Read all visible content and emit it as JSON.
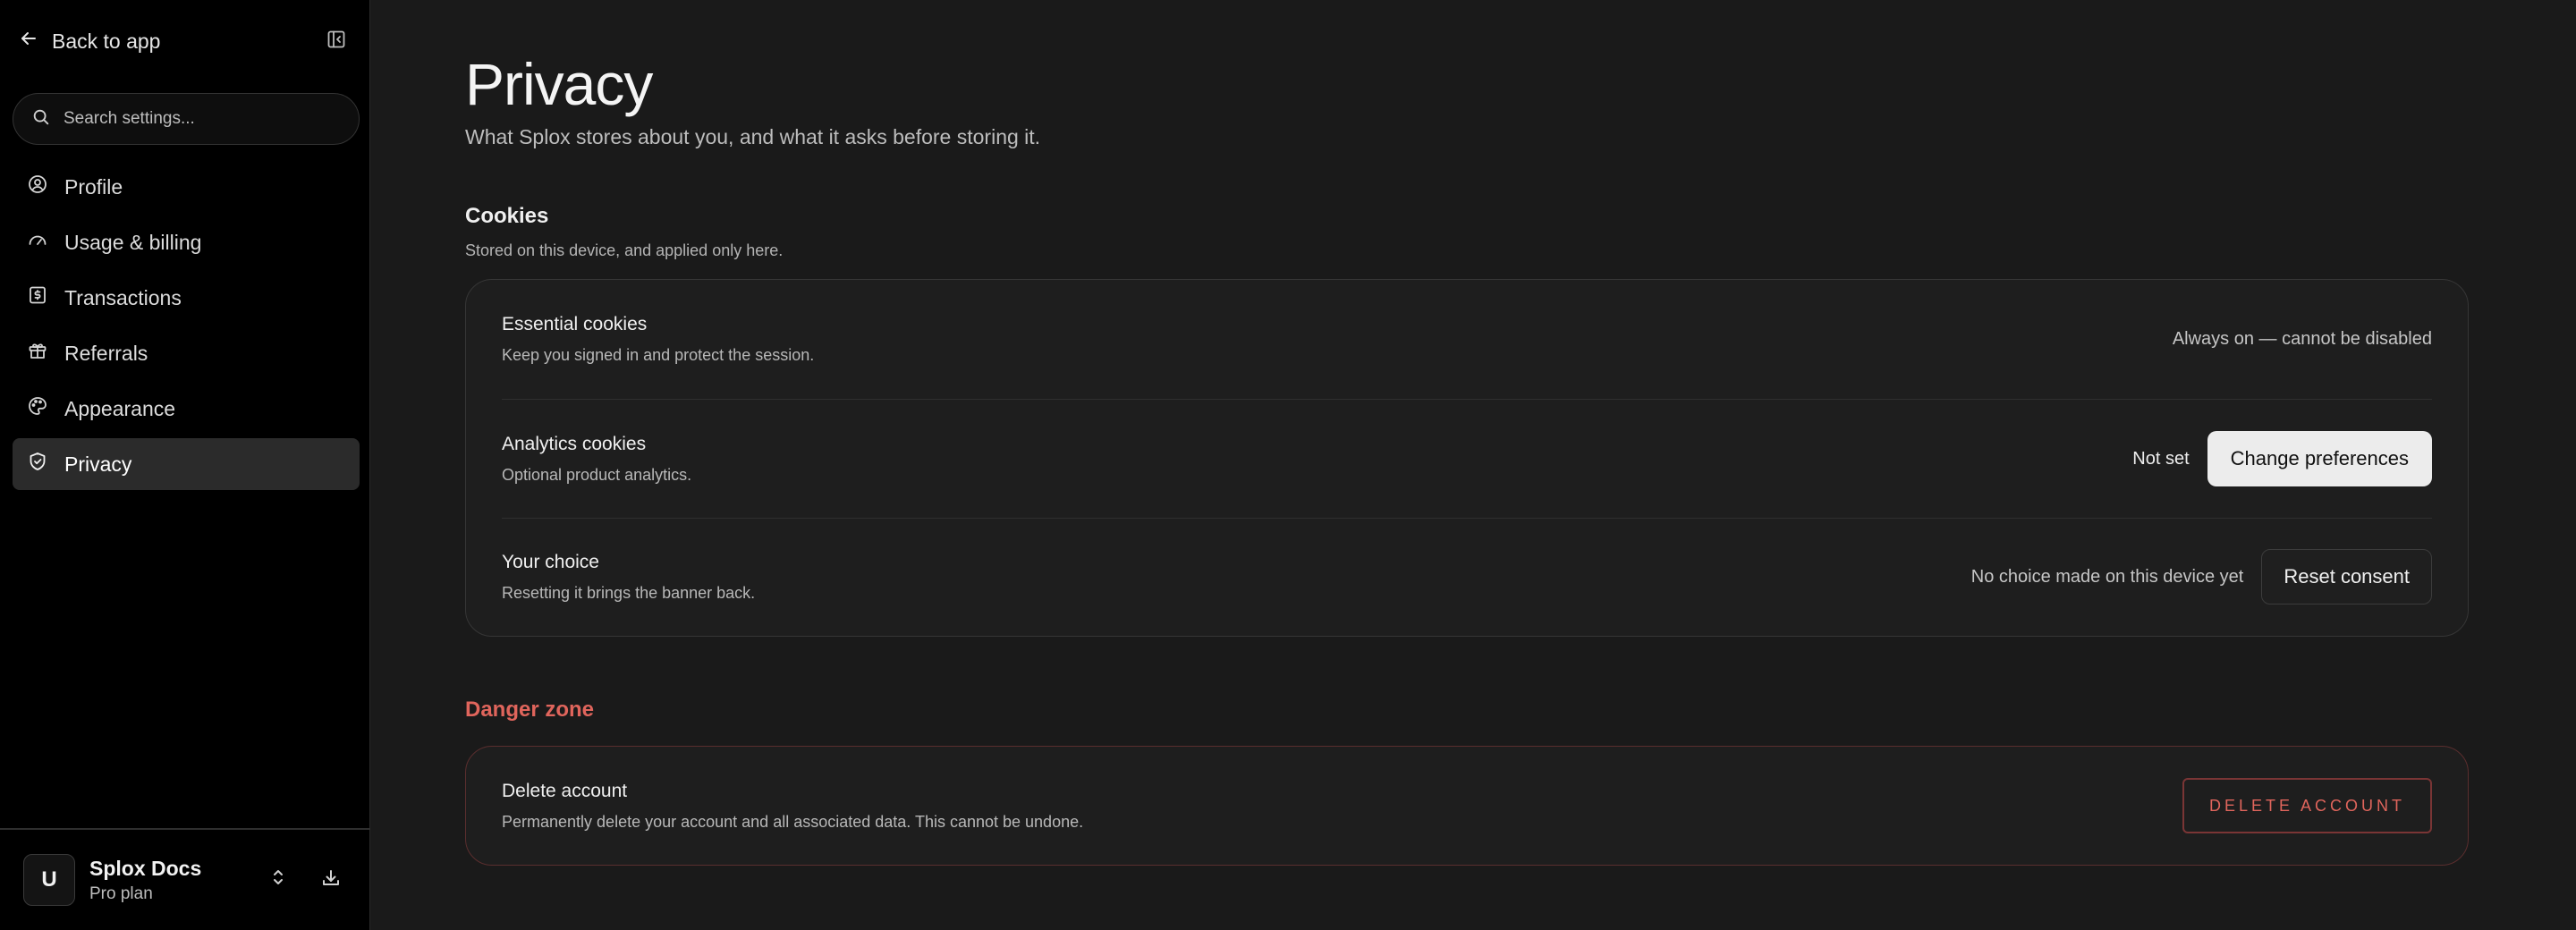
{
  "sidebar": {
    "back_label": "Back to app",
    "search_placeholder": "Search settings...",
    "items": [
      {
        "label": "Profile",
        "icon": "user-circle-icon"
      },
      {
        "label": "Usage & billing",
        "icon": "gauge-icon"
      },
      {
        "label": "Transactions",
        "icon": "dollar-receipt-icon"
      },
      {
        "label": "Referrals",
        "icon": "gift-icon"
      },
      {
        "label": "Appearance",
        "icon": "palette-icon"
      },
      {
        "label": "Privacy",
        "icon": "shield-check-icon",
        "active": true
      }
    ],
    "account": {
      "avatar_initial": "U",
      "name": "Splox Docs",
      "plan": "Pro plan"
    }
  },
  "page": {
    "title": "Privacy",
    "subtitle": "What Splox stores about you, and what it asks before storing it."
  },
  "cookies": {
    "title": "Cookies",
    "description": "Stored on this device, and applied only here.",
    "rows": [
      {
        "title": "Essential cookies",
        "description": "Keep you signed in and protect the session.",
        "status": "Always on — cannot be disabled"
      },
      {
        "title": "Analytics cookies",
        "description": "Optional product analytics.",
        "status": "Not set",
        "button": "Change preferences"
      },
      {
        "title": "Your choice",
        "description": "Resetting it brings the banner back.",
        "status": "No choice made on this device yet",
        "button": "Reset consent"
      }
    ]
  },
  "danger_zone": {
    "title": "Danger zone",
    "row": {
      "title": "Delete account",
      "description": "Permanently delete your account and all associated data. This cannot be undone.",
      "button": "DELETE ACCOUNT"
    }
  },
  "colors": {
    "background": "#1a1a1a",
    "sidebar": "#000000",
    "danger": "#e0655c",
    "active_nav": "#2b2b2b"
  }
}
